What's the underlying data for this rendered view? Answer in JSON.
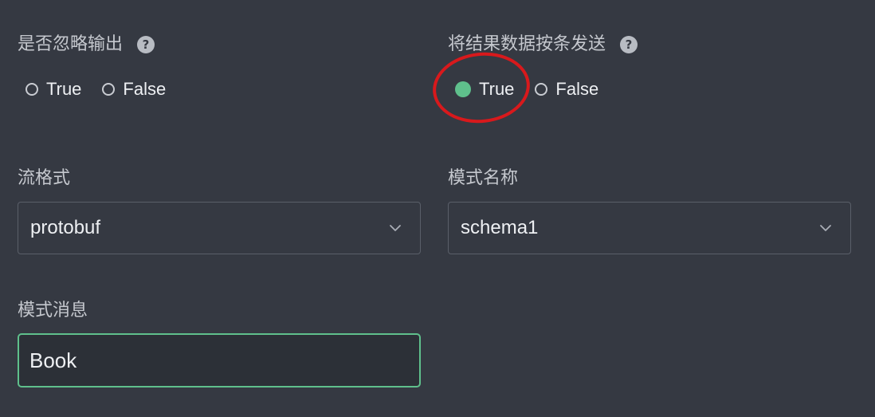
{
  "form": {
    "ignore_output": {
      "label": "是否忽略输出",
      "help": "?",
      "options": [
        "True",
        "False"
      ],
      "selected": null
    },
    "send_by_record": {
      "label": "将结果数据按条发送",
      "help": "?",
      "options": [
        "True",
        "False"
      ],
      "selected": "True"
    },
    "stream_format": {
      "label": "流格式",
      "value": "protobuf"
    },
    "schema_name": {
      "label": "模式名称",
      "value": "schema1"
    },
    "schema_message": {
      "label": "模式消息",
      "value": "Book"
    }
  },
  "colors": {
    "background": "#353942",
    "accent": "#5fc08c",
    "annotation": "#d8191c"
  },
  "icons": {
    "help": "question-circle-icon",
    "dropdown": "chevron-down-icon"
  }
}
